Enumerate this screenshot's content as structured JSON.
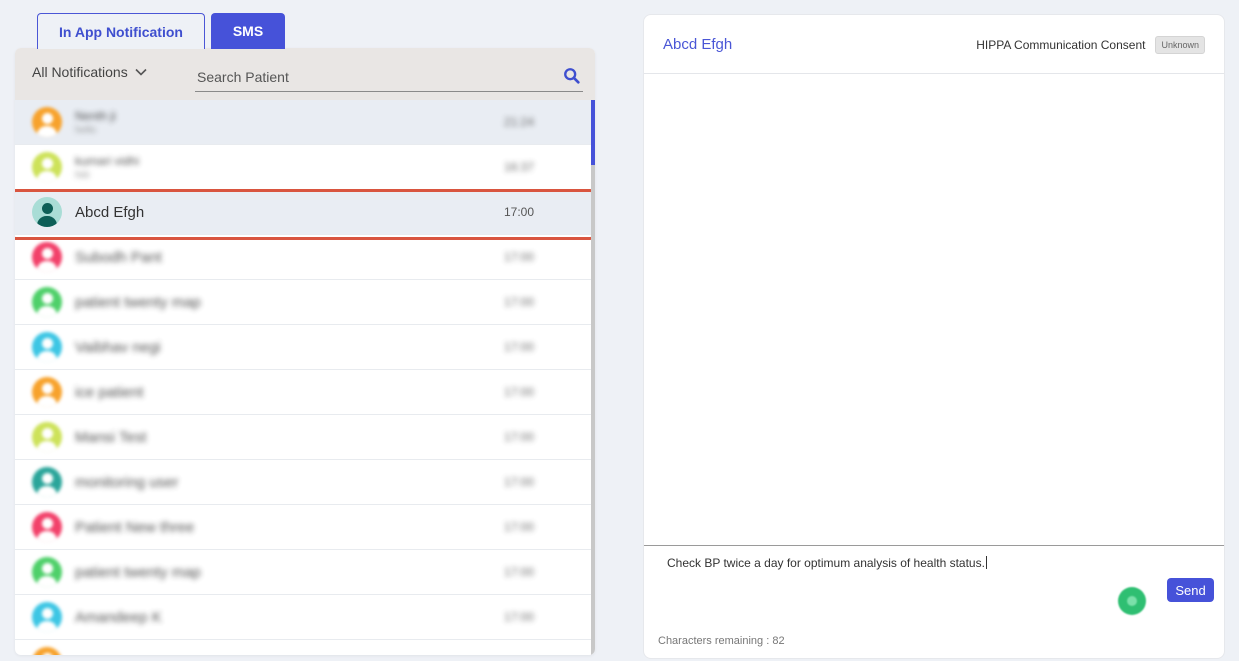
{
  "tabs": [
    {
      "label": "In App Notification"
    },
    {
      "label": "SMS"
    }
  ],
  "list_header": {
    "filter_label": "All Notifications",
    "search_placeholder": "Search Patient"
  },
  "patients": [
    {
      "name": "Nenth ji",
      "preview": "hello",
      "time": "21:24",
      "avatar_color": "#f7a22c",
      "blurred": true,
      "shaded": true
    },
    {
      "name": "kumari vidhi",
      "preview": "hiiii",
      "time": "16:37",
      "avatar_color": "#cde25a",
      "blurred": true
    },
    {
      "name": "Abcd Efgh",
      "preview": "",
      "time": "17:00",
      "avatar_color": "#2aa59a",
      "blurred": false,
      "shaded": true,
      "selected": true
    },
    {
      "name": "Subodh Pant",
      "preview": "",
      "time": "17:00",
      "avatar_color": "#f2416a",
      "blurred": true
    },
    {
      "name": "patient twenty map",
      "preview": "",
      "time": "17:00",
      "avatar_color": "#4fd06a",
      "blurred": true
    },
    {
      "name": "Vaibhav negi",
      "preview": "",
      "time": "17:00",
      "avatar_color": "#3dc6e4",
      "blurred": true
    },
    {
      "name": "ice patient",
      "preview": "",
      "time": "17:00",
      "avatar_color": "#f7a22c",
      "blurred": true
    },
    {
      "name": "Mansi Test",
      "preview": "",
      "time": "17:00",
      "avatar_color": "#cde25a",
      "blurred": true
    },
    {
      "name": "monitoring user",
      "preview": "",
      "time": "17:00",
      "avatar_color": "#2aa59a",
      "blurred": true
    },
    {
      "name": "Patient New three",
      "preview": "",
      "time": "17:00",
      "avatar_color": "#f2416a",
      "blurred": true
    },
    {
      "name": "patient twenty map",
      "preview": "",
      "time": "17:00",
      "avatar_color": "#4fd06a",
      "blurred": true
    },
    {
      "name": "Amandeep K",
      "preview": "",
      "time": "17:00",
      "avatar_color": "#3dc6e4",
      "blurred": true
    },
    {
      "name": "",
      "preview": "",
      "time": "",
      "avatar_color": "#f7a22c",
      "blurred": true
    }
  ],
  "chat": {
    "patient_name": "Abcd Efgh",
    "consent_label": "HIPPA Communication Consent",
    "consent_status": "Unknown",
    "message_text": "Check BP twice a day for optimum analysis of health status.",
    "send_label": "Send",
    "chars_remaining_label": "Characters remaining : 82"
  },
  "colors": {
    "accent": "#4652d9",
    "selection_outline": "#d9553f",
    "background": "#eef1f6"
  }
}
